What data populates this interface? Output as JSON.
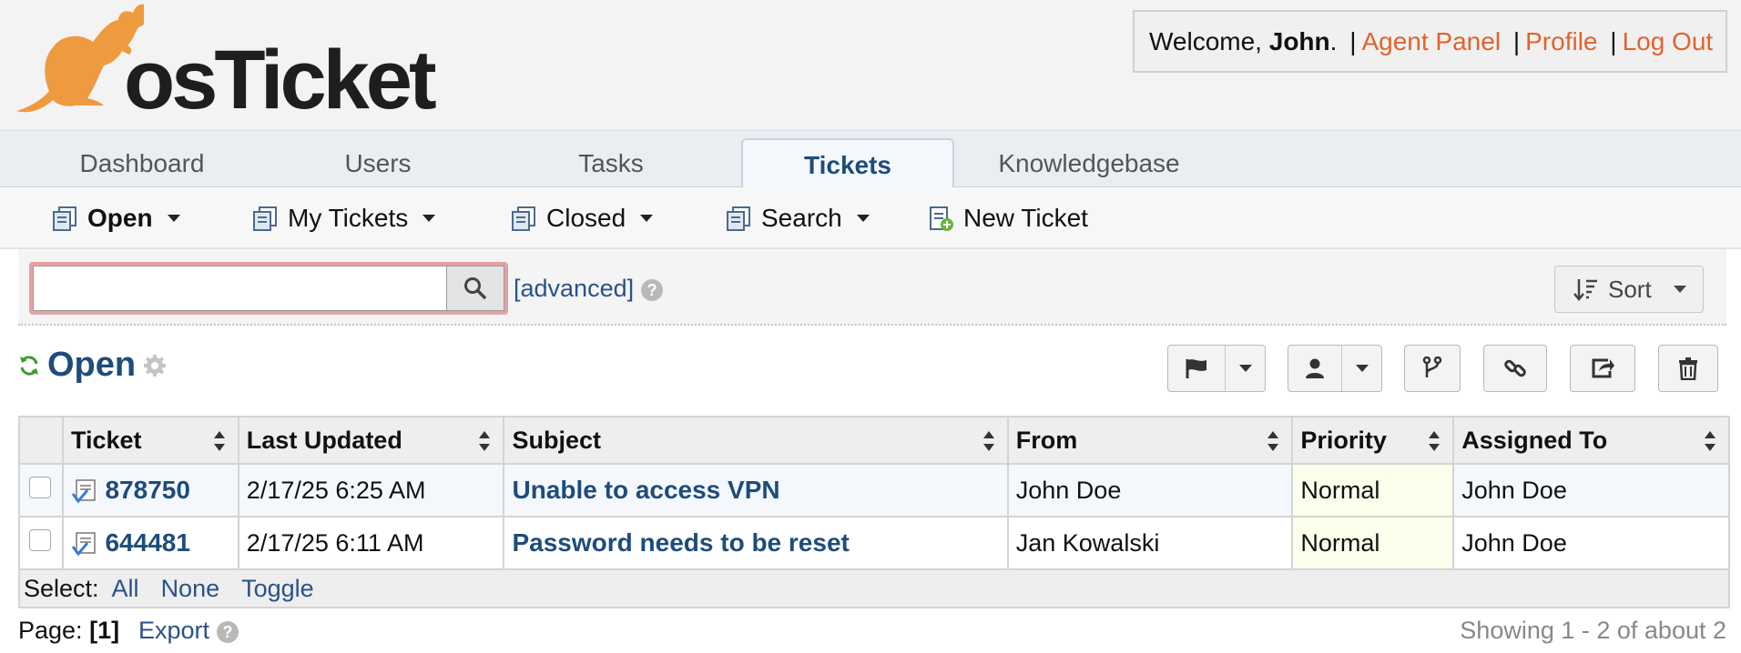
{
  "header": {
    "logo_text": "osTicket",
    "welcome_prefix": "Welcome, ",
    "user_name": "John",
    "user_suffix": ".",
    "links": [
      "Agent Panel",
      "Profile",
      "Log Out"
    ]
  },
  "nav": {
    "tabs": [
      "Dashboard",
      "Users",
      "Tasks",
      "Tickets",
      "Knowledgebase"
    ],
    "active": "Tickets"
  },
  "subnav": {
    "items": [
      "Open",
      "My Tickets",
      "Closed",
      "Search",
      "New Ticket"
    ]
  },
  "search": {
    "placeholder": "",
    "advanced_label": "[advanced]",
    "sort_label": "Sort"
  },
  "queue": {
    "title": "Open"
  },
  "table": {
    "columns": [
      "Ticket",
      "Last Updated",
      "Subject",
      "From",
      "Priority",
      "Assigned To"
    ],
    "rows": [
      {
        "ticket": "878750",
        "updated": "2/17/25 6:25 AM",
        "subject": "Unable to access VPN",
        "from": "John Doe",
        "priority": "Normal",
        "assigned": "John Doe"
      },
      {
        "ticket": "644481",
        "updated": "2/17/25 6:11 AM",
        "subject": "Password needs to be reset",
        "from": "Jan Kowalski",
        "priority": "Normal",
        "assigned": "John Doe"
      }
    ]
  },
  "select": {
    "label": "Select:",
    "options": [
      "All",
      "None",
      "Toggle"
    ]
  },
  "footer": {
    "page_label": "Page:",
    "page_num": "[1]",
    "export_label": "Export",
    "showing": "Showing 1 - 2 of about 2"
  },
  "colors": {
    "brand_orange": "#ee9a3f",
    "link_orange": "#e0632c",
    "link_blue": "#1e4c7b",
    "refresh_green": "#3e9a2f"
  }
}
